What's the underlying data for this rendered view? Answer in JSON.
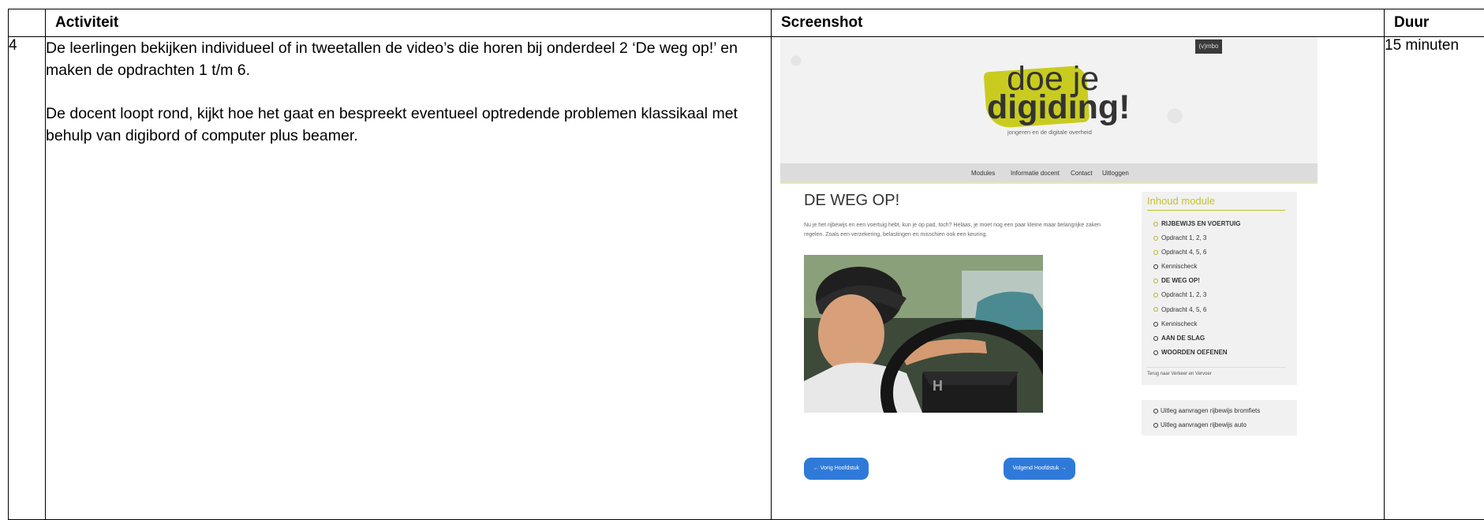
{
  "headers": {
    "activity": "Activiteit",
    "screenshot": "Screenshot",
    "duration": "Duur"
  },
  "row": {
    "number": "4",
    "activity_p1": "De leerlingen bekijken individueel of in tweetallen de video’s die horen bij onderdeel 2 ‘De weg op!’ en maken de opdrachten 1 t/m 6.",
    "activity_p2": "De docent loopt rond, kijkt hoe het gaat en bespreekt eventueel optredende problemen klassikaal met behulp van digibord of computer plus beamer.",
    "duration": "15 minuten"
  },
  "screenshot": {
    "badge": "(v)mbo",
    "logo": {
      "line1": "doe je",
      "line2": "digiding!",
      "tagline": "jongeren en de digitale overheid"
    },
    "nav": [
      "Modules",
      "Informatie docent",
      "Contact",
      "Uitloggen"
    ],
    "title": "DE WEG OP!",
    "intro": "Nu je het rijbewijs en een voertuig hebt, kun je op pad, toch? Helaas, je moet nog een paar kleine maar belangrijke zaken regelen. Zoals een verzekering, belastingen en misschien ook een keuring.",
    "sidebar": {
      "title": "Inhoud module",
      "items": [
        {
          "label": "RIJBEWIJS EN VOERTUIG",
          "green": true,
          "strong": true
        },
        {
          "label": "Opdracht 1, 2, 3",
          "green": true,
          "strong": false
        },
        {
          "label": "Opdracht 4, 5, 6",
          "green": true,
          "strong": false
        },
        {
          "label": "Kennischeck",
          "green": false,
          "strong": false
        },
        {
          "label": "DE WEG OP!",
          "green": true,
          "strong": true
        },
        {
          "label": "Opdracht 1, 2, 3",
          "green": true,
          "strong": false
        },
        {
          "label": "Opdracht 4, 5, 6",
          "green": true,
          "strong": false
        },
        {
          "label": "Kennischeck",
          "green": false,
          "strong": false
        },
        {
          "label": "AAN DE SLAG",
          "green": false,
          "strong": true
        },
        {
          "label": "WOORDEN OEFENEN",
          "green": false,
          "strong": true
        }
      ],
      "back_link": "Terug naar Verkeer en Vervoer"
    },
    "links": [
      "Uitleg aanvragen rijbewijs bromfiets",
      "Uitleg aanvragen rijbewijs auto"
    ],
    "prev_button": "← Vorig Hoofdstuk",
    "next_button": "Volgend Hoofdstuk →"
  }
}
